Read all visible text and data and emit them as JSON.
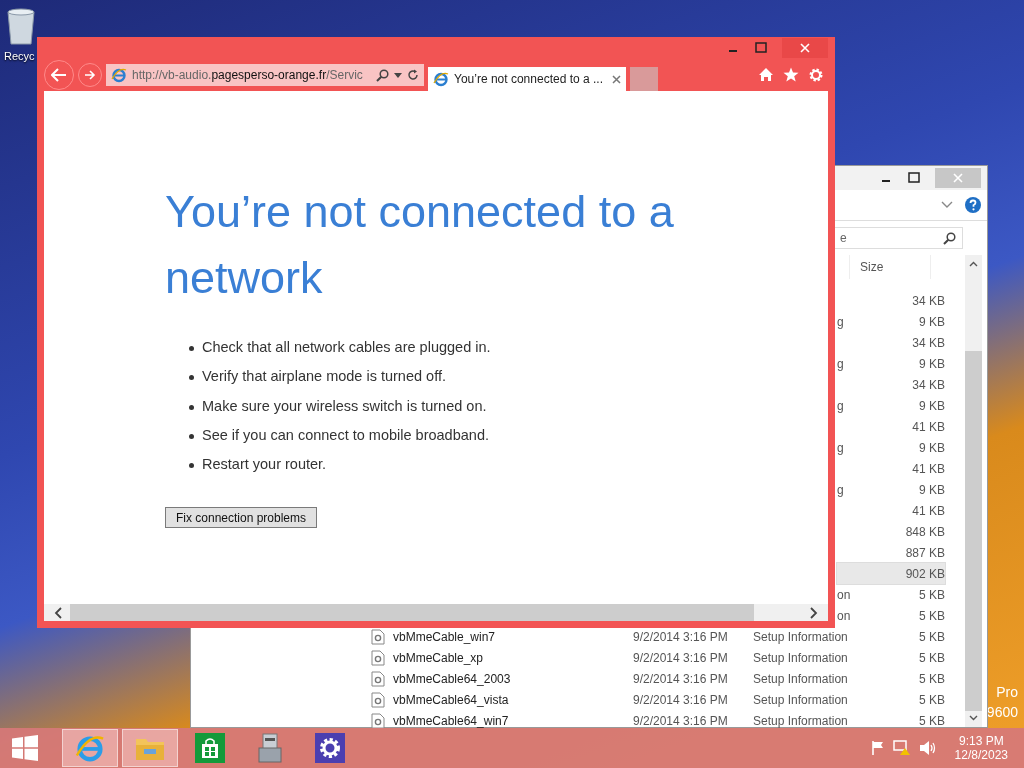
{
  "desktop": {
    "icons": [
      {
        "label": "Recyc"
      }
    ],
    "watermark": [
      "Pro",
      "9600"
    ]
  },
  "explorer": {
    "search": {
      "placeholder": "e"
    },
    "columns": [
      "Size"
    ],
    "rows": [
      {
        "type": "",
        "size": "34 KB",
        "selected": false
      },
      {
        "type": "g",
        "size": "9 KB",
        "selected": false
      },
      {
        "type": "",
        "size": "34 KB",
        "selected": false
      },
      {
        "type": "g",
        "size": "9 KB",
        "selected": false
      },
      {
        "type": "",
        "size": "34 KB",
        "selected": false
      },
      {
        "type": "g",
        "size": "9 KB",
        "selected": false
      },
      {
        "type": "",
        "size": "41 KB",
        "selected": false
      },
      {
        "type": "g",
        "size": "9 KB",
        "selected": false
      },
      {
        "type": "",
        "size": "41 KB",
        "selected": false
      },
      {
        "type": "g",
        "size": "9 KB",
        "selected": false
      },
      {
        "type": "",
        "size": "41 KB",
        "selected": false
      },
      {
        "type": "",
        "size": "848 KB",
        "selected": false
      },
      {
        "type": "",
        "size": "887 KB",
        "selected": false
      },
      {
        "type": "",
        "size": "902 KB",
        "selected": true
      },
      {
        "type": "on",
        "size": "5 KB",
        "selected": false
      },
      {
        "type": "on",
        "size": "5 KB",
        "selected": false
      },
      {
        "name": "vbMmeCable_win7",
        "date": "9/2/2014 3:16 PM",
        "type": "Setup Information",
        "size": "5 KB",
        "selected": false
      },
      {
        "name": "vbMmeCable_xp",
        "date": "9/2/2014 3:16 PM",
        "type": "Setup Information",
        "size": "5 KB",
        "selected": false
      },
      {
        "name": "vbMmeCable64_2003",
        "date": "9/2/2014 3:16 PM",
        "type": "Setup Information",
        "size": "5 KB",
        "selected": false
      },
      {
        "name": "vbMmeCable64_vista",
        "date": "9/2/2014 3:16 PM",
        "type": "Setup Information",
        "size": "5 KB",
        "selected": false
      },
      {
        "name": "vbMmeCable64_win7",
        "date": "9/2/2014 3:16 PM",
        "type": "Setup Information",
        "size": "5 KB",
        "selected": false
      }
    ]
  },
  "browser": {
    "address": "http://vb-audio.**pagesperso-orange.fr**/Servic",
    "tabs": [
      {
        "title": "You’re not connected to a ...",
        "selected": true
      }
    ],
    "page": {
      "heading": "You’re not connected to a network",
      "tips": [
        "Check that all network cables are plugged in.",
        "Verify that airplane mode is turned off.",
        "Make sure your wireless switch is turned on.",
        "See if you can connect to mobile broadband.",
        "Restart your router."
      ],
      "button": "Fix connection problems"
    }
  },
  "taskbar": {
    "apps": [
      {
        "kind": "browser",
        "running": true
      },
      {
        "kind": "folder",
        "running": true
      },
      {
        "kind": "store",
        "running": false
      },
      {
        "kind": "device",
        "running": false
      },
      {
        "kind": "settings",
        "running": false
      }
    ],
    "clock": {
      "time": "9:13 PM",
      "date": "12/8/2023"
    }
  }
}
